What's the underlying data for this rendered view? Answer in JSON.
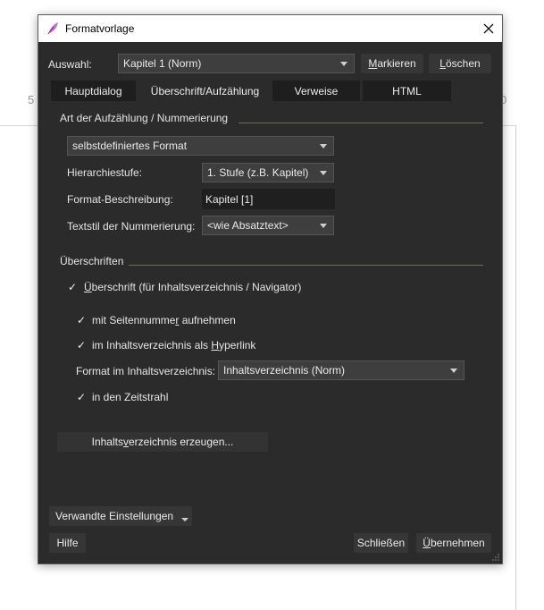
{
  "background": {
    "num_left": "5",
    "num_right": "0"
  },
  "dialog": {
    "title": "Formatvorlage",
    "auswahl_label": "Auswahl:",
    "auswahl_value": "Kapitel 1 (Norm)",
    "markieren_pre": "M",
    "markieren_post": "arkieren",
    "loeschen_pre": "L",
    "loeschen_post": "öschen",
    "tabs": [
      "Hauptdialog",
      "Überschrift/Aufzählung",
      "Verweise",
      "HTML"
    ],
    "section1_title": "Art der Aufzählung / Nummerierung",
    "format_type": "selbstdefiniertes Format",
    "hierarchie_label": "Hierarchiestufe:",
    "hierarchie_value": "1. Stufe (z.B. Kapitel)",
    "beschreibung_label": "Format-Beschreibung:",
    "beschreibung_value": "Kapitel [1]",
    "textstil_label": "Textstil der Nummerierung:",
    "textstil_value": "<wie Absatztext>",
    "section2_title": "Überschriften",
    "cb_ueberschrift_pre": "Ü",
    "cb_ueberschrift_post": "berschrift (für Inhaltsverzeichnis / Navigator)",
    "cb_seitennummer_pre": "mit Seitennumme",
    "cb_seitennummer_u": "r",
    "cb_seitennummer_post": " aufnehmen",
    "cb_hyperlink_pre": "im Inhaltsverzeichnis als ",
    "cb_hyperlink_u": "H",
    "cb_hyperlink_post": "yperlink",
    "format_iv_label": "Format im Inhaltsverzeichnis:",
    "format_iv_value": "Inhaltsverzeichnis (Norm)",
    "cb_zeitstrahl": "in den Zeitstrahl",
    "iv_btn_pre": "Inhalts",
    "iv_btn_u": "v",
    "iv_btn_post": "erzeichnis erzeugen...",
    "verwandte_label": "Verwandte Einstellungen",
    "hilfe_label": "Hilfe",
    "schliessen_label": "Schließen",
    "uebernehmen_pre": "Ü",
    "uebernehmen_post": "bernehmen"
  }
}
